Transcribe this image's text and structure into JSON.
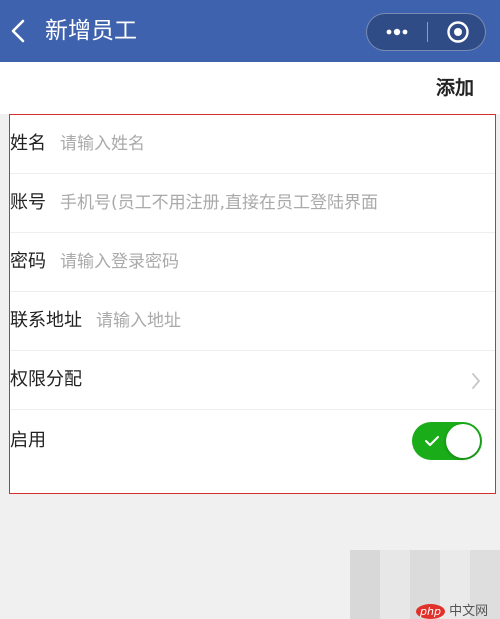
{
  "nav": {
    "title": "新增员工",
    "icons": [
      "back-icon",
      "more-icon",
      "close-circle-icon"
    ],
    "background_color": "#3e62ae"
  },
  "toolbar": {
    "add_label": "添加"
  },
  "form": {
    "name": {
      "label": "姓名",
      "value": "",
      "placeholder": "请输入姓名"
    },
    "account": {
      "label": "账号",
      "value": "",
      "placeholder": "手机号(员工不用注册,直接在员工登陆界面"
    },
    "password": {
      "label": "密码",
      "value": "",
      "placeholder": "请输入登录密码"
    },
    "address": {
      "label": "联系地址",
      "value": "",
      "placeholder": "请输入地址"
    },
    "permissions": {
      "label": "权限分配"
    },
    "enabled": {
      "label": "启用",
      "on": true,
      "on_color": "#1aad19"
    }
  },
  "watermark": {
    "logo_text": "php",
    "site_text": "中文网"
  }
}
